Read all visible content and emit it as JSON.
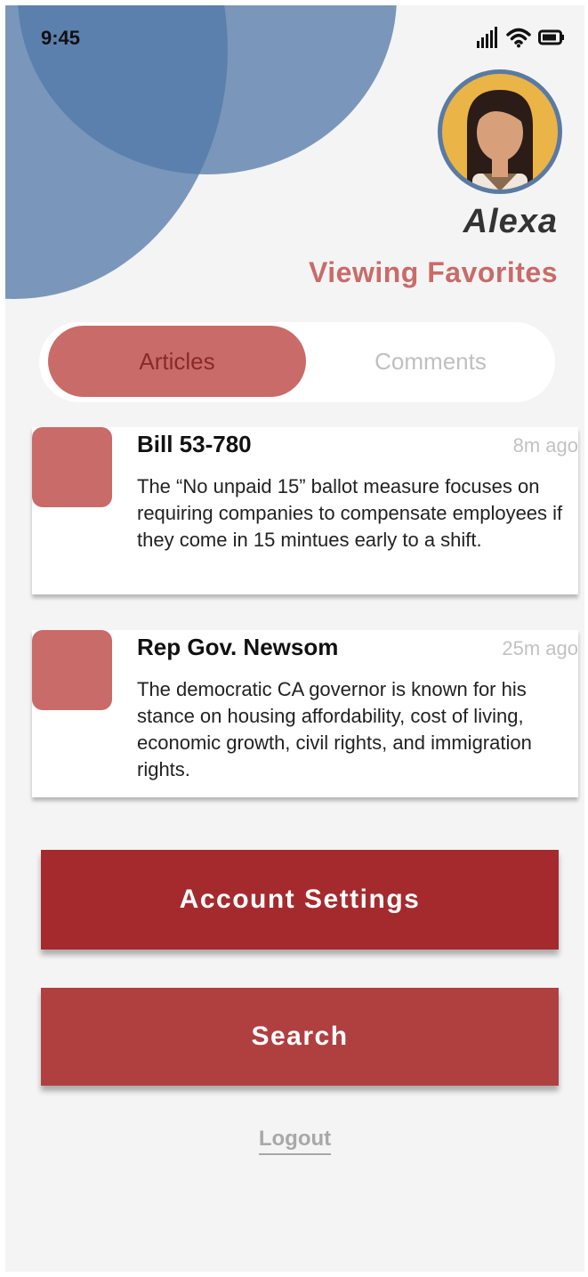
{
  "status_bar": {
    "time": "9:45"
  },
  "profile": {
    "name": "Alexa",
    "subtitle": "Viewing Favorites"
  },
  "tabs": {
    "active": "Articles",
    "inactive": "Comments"
  },
  "favorites": [
    {
      "title": "Bill 53-780",
      "time": "8m ago",
      "body": "The “No unpaid 15” ballot measure focuses on requiring companies to compensate employees if they come in 15 mintues early to a shift."
    },
    {
      "title": "Rep Gov. Newsom",
      "time": "25m ago",
      "body": "The democratic CA governor is known for his stance on housing affordability, cost of living, economic growth, civil rights, and immigration rights."
    }
  ],
  "actions": {
    "account_settings": "Account Settings",
    "search": "Search",
    "logout": "Logout"
  },
  "colors": {
    "accent_blue": "#5278a8",
    "rose": "#c96b68",
    "dark_red": "#a52a2d",
    "red": "#b04040"
  },
  "icons": [
    "signal-icon",
    "wifi-icon",
    "battery-icon"
  ]
}
